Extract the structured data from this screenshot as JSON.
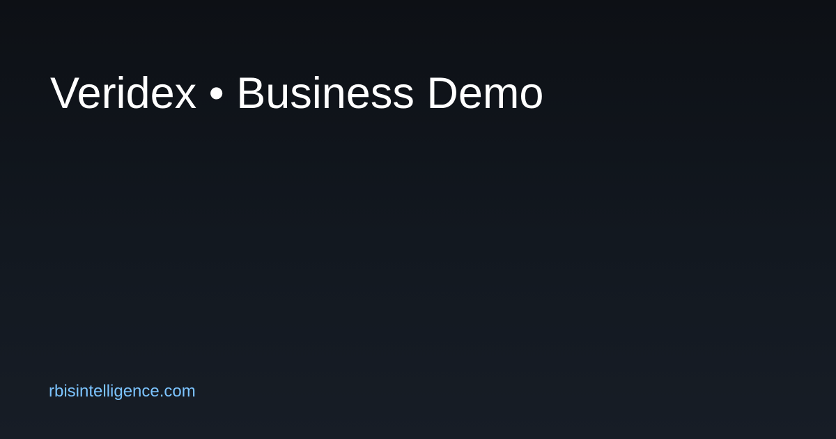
{
  "card": {
    "title": "Veridex • Business Demo",
    "domain": "rbisintelligence.com"
  },
  "colors": {
    "background_top": "#0d1015",
    "background_bottom": "#171d26",
    "title_text": "#ffffff",
    "domain_text": "#7cc4ff"
  }
}
